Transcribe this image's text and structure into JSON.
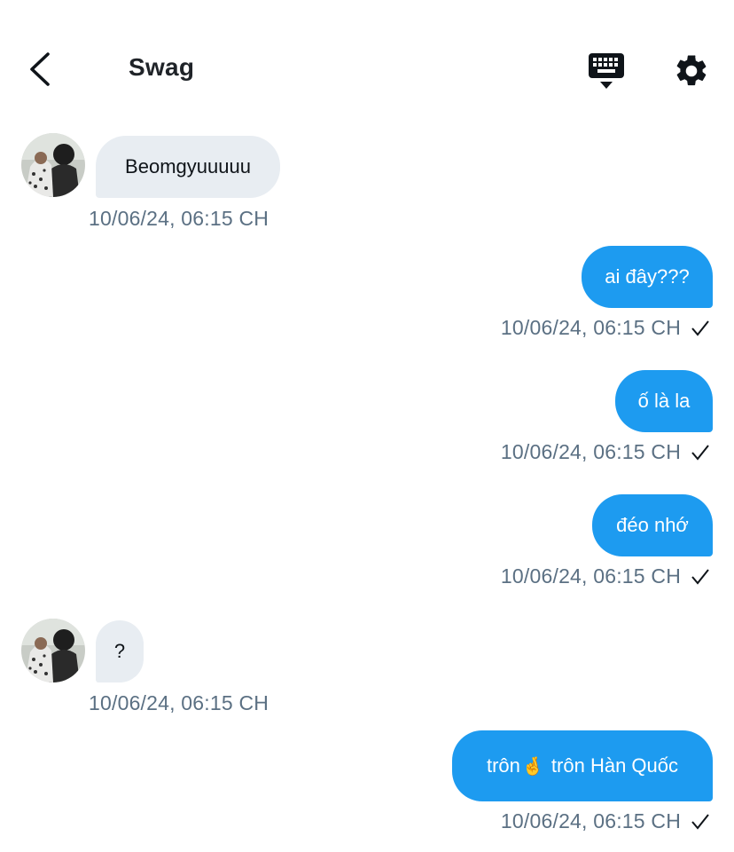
{
  "header": {
    "title": "Swag",
    "back_icon": "chevron-left-icon",
    "keyboard_icon": "keyboard-icon",
    "settings_icon": "gear-icon"
  },
  "colors": {
    "outgoing_bubble": "#1d9bf0",
    "incoming_bubble": "#e8edf2",
    "timestamp": "#5b7083"
  },
  "messages": [
    {
      "direction": "in",
      "text": "Beomgyuuuuu",
      "time": "10/06/24, 06:15 CH"
    },
    {
      "direction": "out",
      "text": "ai đây???",
      "time": "10/06/24, 06:15 CH",
      "status_icon": "check-icon"
    },
    {
      "direction": "out",
      "text": "ố là la",
      "time": "10/06/24, 06:15 CH",
      "status_icon": "check-icon"
    },
    {
      "direction": "out",
      "text": "đéo nhớ",
      "time": "10/06/24, 06:15 CH",
      "status_icon": "check-icon"
    },
    {
      "direction": "in",
      "text": "?",
      "time": "10/06/24, 06:15 CH"
    },
    {
      "direction": "out",
      "text_before": "trôn",
      "emoji": "🤞",
      "text_after": " trôn Hàn Quốc",
      "time": "10/06/24, 06:15 CH",
      "status_icon": "check-icon"
    }
  ]
}
